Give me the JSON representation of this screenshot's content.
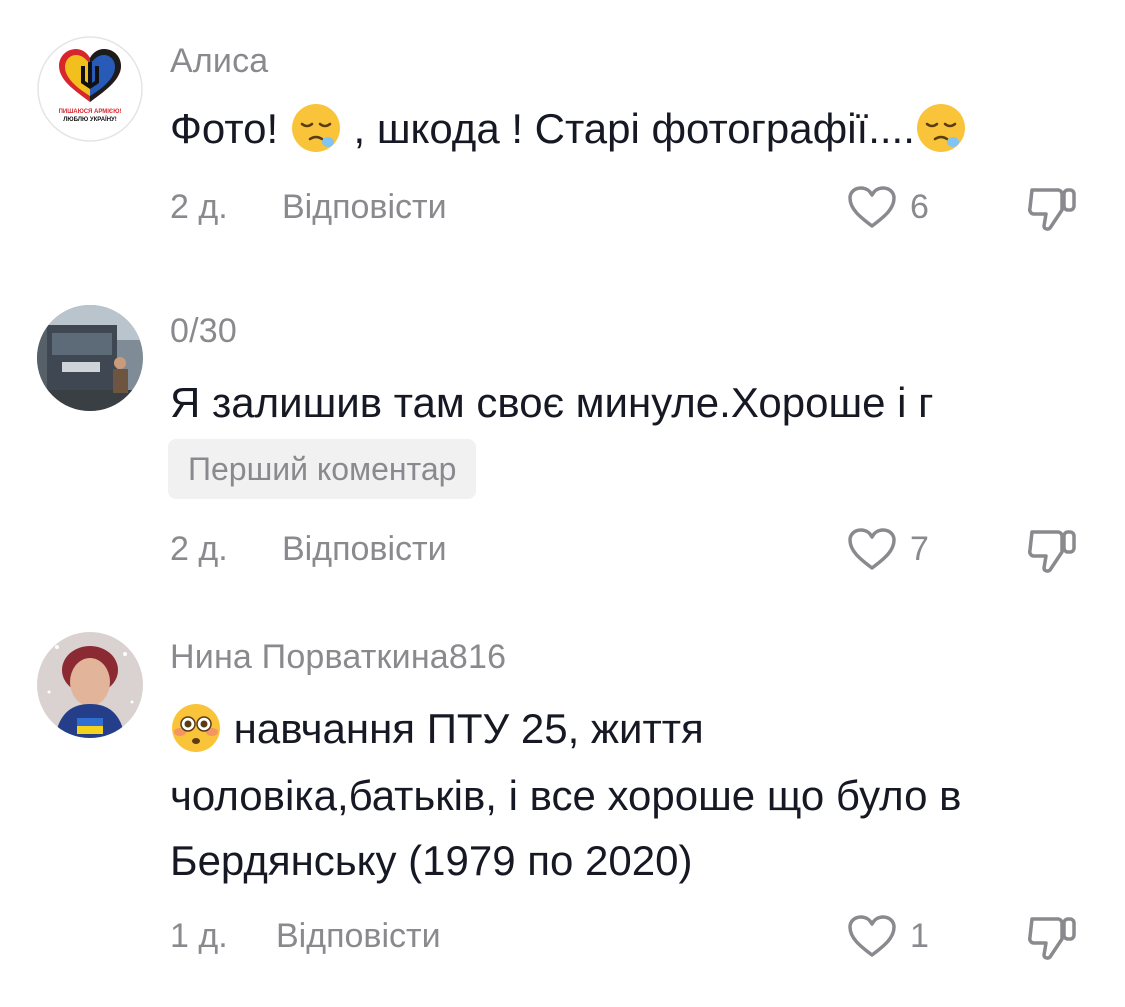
{
  "comments": [
    {
      "username": "Алиса",
      "avatar_icon": "heart-trident-logo",
      "avatar_caption_1": "ПИШАЮСЯ АРМІЄЮ!",
      "avatar_caption_2": "ЛЮБЛЮ УКРАЇНУ!",
      "text_before": "Фото! ",
      "text_middle": " , шкода ! Старі фотографії....",
      "emoji": "sleepy-face",
      "time": "2 д.",
      "reply_label": "Відповісти",
      "likes": "6"
    },
    {
      "username": "0/30",
      "avatar_icon": "truck-photo",
      "text": "Я залишив там своє минуле.Хороше і г",
      "badge": "Перший коментар",
      "time": "2 д.",
      "reply_label": "Відповісти",
      "likes": "7"
    },
    {
      "username": "Нина Порваткина816",
      "avatar_icon": "woman-portrait-photo",
      "emoji": "flushed-face",
      "text_line1": " навчання ПТУ 25, життя",
      "text_line2": "чоловіка,батьків, і все хороше що було в",
      "text_line3": "Бердянську (1979 по 2020)",
      "time": "1 д.",
      "reply_label": "Відповісти",
      "likes": "1"
    }
  ],
  "colors": {
    "text": "#161823",
    "muted": "#8a8a8e",
    "badge_bg": "#f1f1f2"
  }
}
